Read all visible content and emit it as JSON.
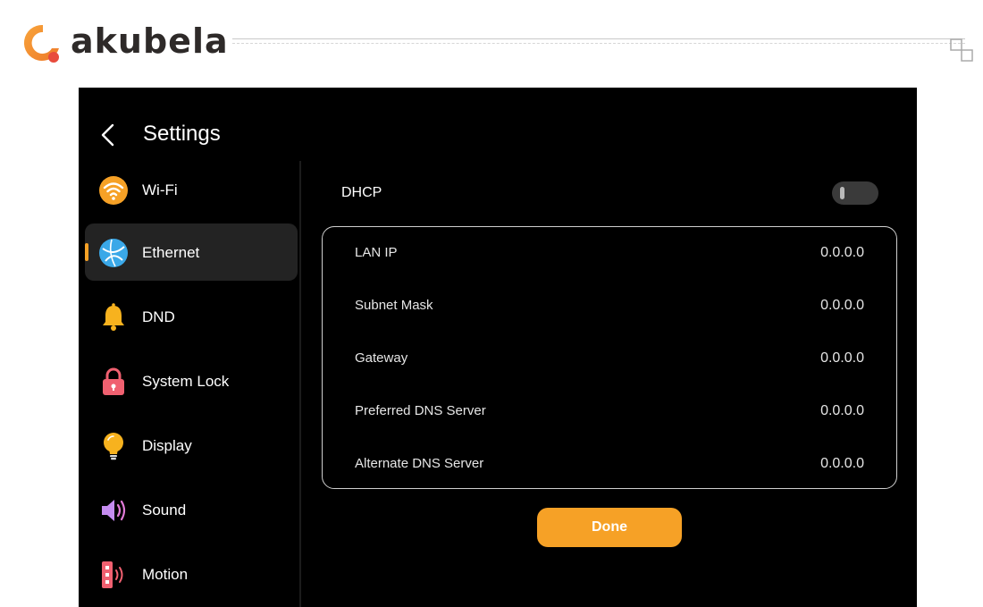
{
  "brand": {
    "name": "akubela"
  },
  "header": {
    "title": "Settings"
  },
  "sidebar": {
    "items": [
      {
        "label": "Wi-Fi",
        "icon": "wifi-icon"
      },
      {
        "label": "Ethernet",
        "icon": "ethernet-globe-icon",
        "active": true
      },
      {
        "label": "DND",
        "icon": "bell-icon"
      },
      {
        "label": "System Lock",
        "icon": "lock-icon"
      },
      {
        "label": "Display",
        "icon": "lightbulb-icon"
      },
      {
        "label": "Sound",
        "icon": "speaker-icon"
      },
      {
        "label": "Motion",
        "icon": "motion-sensor-icon"
      }
    ]
  },
  "dhcp": {
    "label": "DHCP",
    "enabled": false
  },
  "network": {
    "rows": [
      {
        "label": "LAN IP",
        "value": "0.0.0.0"
      },
      {
        "label": "Subnet Mask",
        "value": "0.0.0.0"
      },
      {
        "label": "Gateway",
        "value": "0.0.0.0"
      },
      {
        "label": "Preferred DNS Server",
        "value": "0.0.0.0"
      },
      {
        "label": "Alternate DNS Server",
        "value": "0.0.0.0"
      }
    ]
  },
  "actions": {
    "done_label": "Done"
  },
  "colors": {
    "accent": "#f6a126",
    "background": "#000000",
    "logo_red": "#e84b3c"
  }
}
